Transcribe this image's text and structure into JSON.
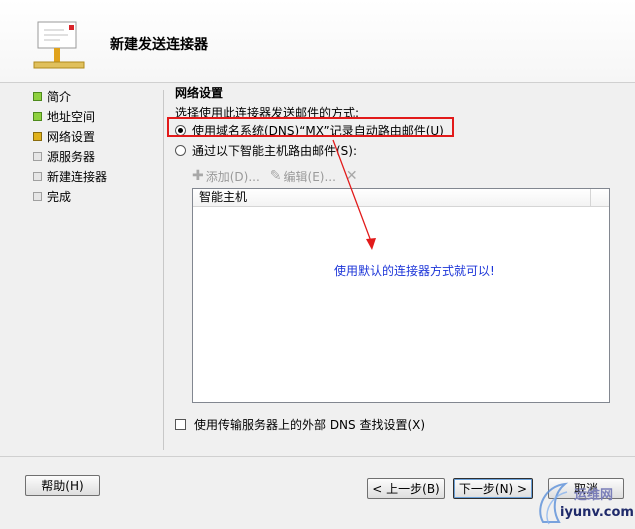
{
  "header": {
    "title": "新建发送连接器",
    "icon": "connector-icon"
  },
  "nav": {
    "items": [
      {
        "label": "简介",
        "state": "done"
      },
      {
        "label": "地址空间",
        "state": "done"
      },
      {
        "label": "网络设置",
        "state": "current"
      },
      {
        "label": "源服务器",
        "state": "pending"
      },
      {
        "label": "新建连接器",
        "state": "pending"
      },
      {
        "label": "完成",
        "state": "pending"
      }
    ]
  },
  "main": {
    "section_title": "网络设置",
    "prompt": "选择使用此连接器发送邮件的方式:",
    "option_dns": "使用域名系统(DNS)“MX”记录自动路由邮件(U)",
    "option_smarthost": "通过以下智能主机路由邮件(S):",
    "toolbar": {
      "add": "添加(D)...",
      "edit": "编辑(E)..."
    },
    "list": {
      "column_header": "智能主机"
    },
    "annotation": "使用默认的连接器方式就可以!",
    "external_dns": "使用传输服务器上的外部 DNS 查找设置(X)"
  },
  "footer": {
    "help": "帮助(H)",
    "back": "< 上一步(B)",
    "next": "下一步(N) >",
    "cancel": "取消"
  },
  "watermark": {
    "line1": "运维网",
    "line2": "iyunv.com"
  },
  "colors": {
    "highlight": "#e21a1a",
    "annotation": "#1c35d8",
    "done": "#8fd13f",
    "current": "#e0b21c"
  }
}
